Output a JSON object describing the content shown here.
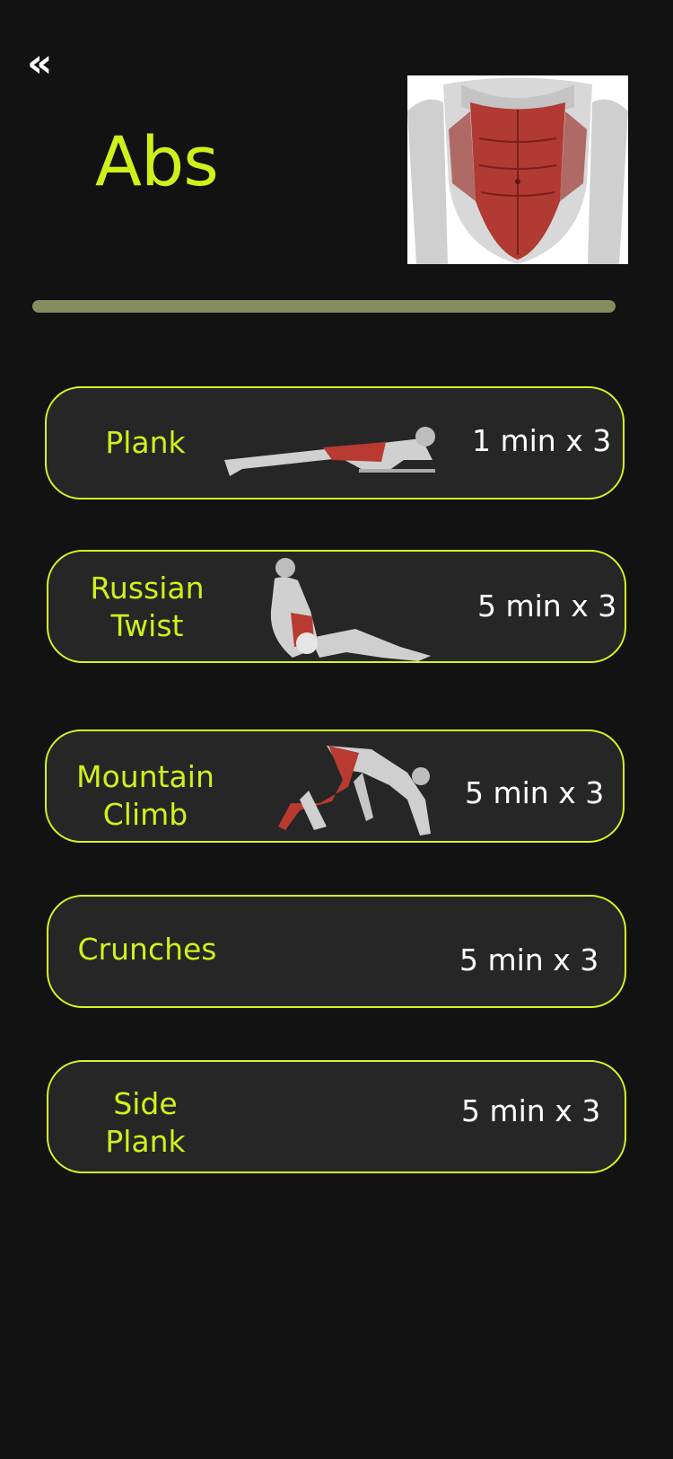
{
  "header": {
    "back_icon": "«",
    "title": "Abs",
    "hero_image": "abdominal-muscles-illustration"
  },
  "progress": {
    "fill_fraction": 1.0
  },
  "exercises": [
    {
      "name": "Plank",
      "duration": "1 min x 3",
      "image": "plank-illustration"
    },
    {
      "name": "Russian\nTwist",
      "duration": "5 min x 3",
      "image": "russian-twist-illustration"
    },
    {
      "name": "Mountain\nClimb",
      "duration": "5 min x 3",
      "image": "mountain-climb-illustration"
    },
    {
      "name": "Crunches",
      "duration": "5 min x 3"
    },
    {
      "name": "Side Plank",
      "duration": "5 min x 3"
    }
  ],
  "colors": {
    "background": "#121212",
    "card": "#262626",
    "accent": "#cdf21a",
    "progress": "#858c5d",
    "text": "#ffffff"
  }
}
